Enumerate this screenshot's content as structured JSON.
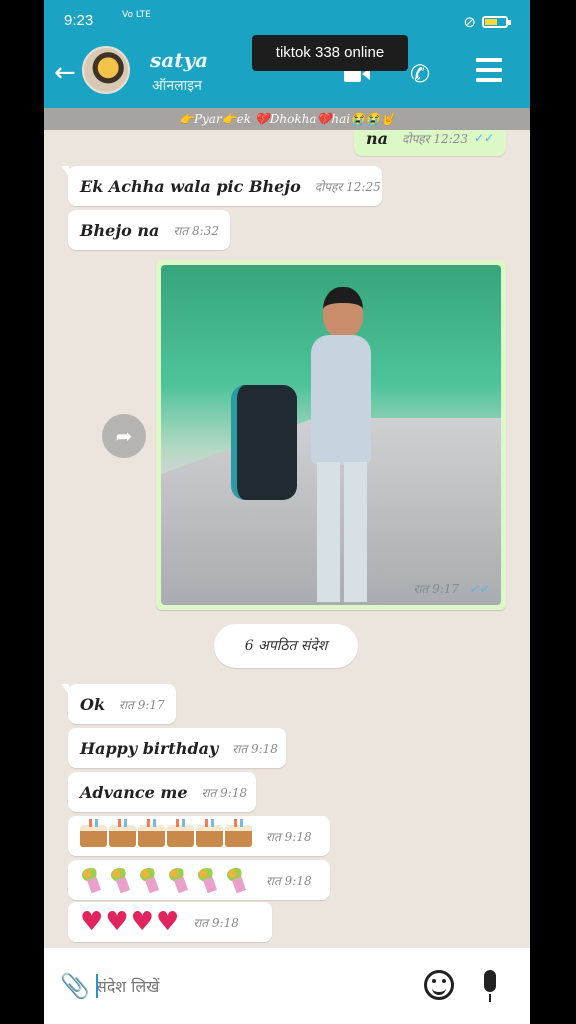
{
  "status_bar": {
    "time": "9:23",
    "network": "Vo LTE",
    "battery_level": 0.55
  },
  "header": {
    "back_icon": "back-arrow-icon",
    "contact_name": "satya",
    "contact_status": "ऑनलाइन",
    "video_icon": "video-call-icon",
    "call_icon": "phone-icon",
    "menu_icon": "menu-icon"
  },
  "toast": {
    "text": "tiktok 338 online"
  },
  "banner": {
    "text": "👉Pyar👉ek 💔Dhokha💔hai😭😭🤘"
  },
  "messages": [
    {
      "dir": "out",
      "text": "na",
      "time": "दोपहर 12:23",
      "ticks": "✓✓"
    },
    {
      "dir": "in",
      "text": "Ek Achha wala pic Bhejo",
      "time": "दोपहर 12:25"
    },
    {
      "dir": "in",
      "text": "Bhejo na",
      "time": "रात 8:32"
    },
    {
      "dir": "out",
      "type": "image",
      "time": "रात 9:17",
      "ticks": "✓✓"
    },
    {
      "dir": "in",
      "text": "Ok",
      "time": "रात 9:17"
    },
    {
      "dir": "in",
      "text": "Happy birthday",
      "time": "रात 9:18"
    },
    {
      "dir": "in",
      "text": "Advance me",
      "time": "रात 9:18"
    },
    {
      "dir": "in",
      "emoji": "cake",
      "count": 6,
      "time": "रात 9:18"
    },
    {
      "dir": "in",
      "emoji": "bouquet",
      "count": 6,
      "time": "रात 9:18"
    },
    {
      "dir": "in",
      "emoji": "heart",
      "count": 4,
      "time": "रात 9:18"
    }
  ],
  "unread_divider": {
    "text": "6 अपठित संदेश"
  },
  "input_bar": {
    "placeholder": "संदेश लिखें",
    "attach_icon": "paperclip-icon",
    "emoji_icon": "emoji-icon",
    "mic_icon": "mic-icon"
  }
}
